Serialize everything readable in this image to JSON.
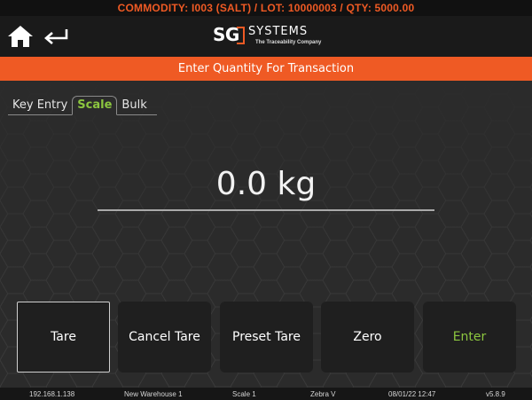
{
  "commodity_banner": "COMMODITY: I003 (SALT) / LOT: 10000003 / QTY: 5000.00",
  "header": {
    "logo_text": "SG",
    "logo_name": "SYSTEMS",
    "logo_tagline": "The Traceability Company",
    "home_icon": "home-icon",
    "back_icon": "back-arrow-icon"
  },
  "title": "Enter Quantity For Transaction",
  "tabs": [
    {
      "label": "Key Entry",
      "active": false
    },
    {
      "label": "Scale",
      "active": true
    },
    {
      "label": "Bulk",
      "active": false
    }
  ],
  "quantity_display": "0.0 kg",
  "buttons": {
    "tare": "Tare",
    "cancel_tare": "Cancel Tare",
    "preset_tare": "Preset Tare",
    "zero": "Zero",
    "enter": "Enter"
  },
  "status": {
    "ip": "192.168.1.138",
    "warehouse": "New Warehouse 1",
    "scale": "Scale 1",
    "printer": "Zebra V",
    "datetime": "08/01/22 12:47",
    "version": "v5.8.9"
  },
  "colors": {
    "accent_orange": "#ef5a24",
    "accent_green": "#8cc63f",
    "background": "#2b2b2b"
  }
}
